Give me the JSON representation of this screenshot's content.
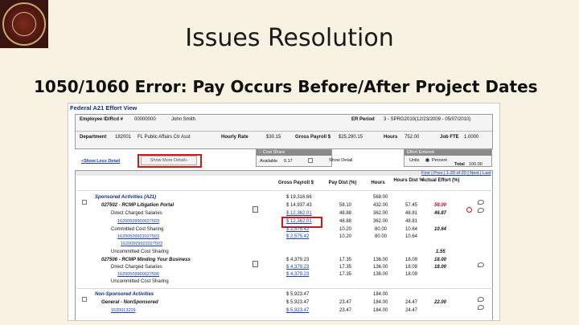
{
  "slide": {
    "title": "Issues Resolution",
    "subtitle": "1050/1060 Error: Pay Occurs Before/After Project Dates",
    "seal": {
      "ring_text": "FLORIDA STATE UNIVERSITY",
      "year": "1851"
    }
  },
  "colors": {
    "background": "#f7f2e1",
    "seal": "#4a1510",
    "highlight": "#d01818",
    "link": "#1a3fb0",
    "navy": "#15307a"
  },
  "screen": {
    "panel_title": "Federal A21 Effort View",
    "header": {
      "employee_label": "Employee ID/Rcd #",
      "employee_value": "00000000",
      "employee_name": "John Smith",
      "er_period_label": "ER Period",
      "er_period_value": "3 - SPRG2010(12/23/2009 - 05/07/2010)",
      "department_label": "Department",
      "department_id": "182001",
      "department_name": "FL Public Affairs Ctr Asst",
      "hourly_rate_label": "Hourly Rate",
      "hourly_rate_value": "$30.15",
      "gross_payroll_label": "Gross Payroll $",
      "gross_payroll_value": "$25,290.15",
      "hours_label": "Hours",
      "hours_value": "752.00",
      "job_fte_label": "Job FTE",
      "job_fte_value": "1.0000"
    },
    "controls": {
      "show_less": "Show Less Detail",
      "show_more": "Show More Detail",
      "cost_share_title": "Cost Share",
      "available_label": "Available",
      "available_value": "0.17",
      "show_detail_label": "Show Detail",
      "effort_title": "Effort Entered",
      "units_label": "Units",
      "percent_label": "Percent",
      "total_label": "Total",
      "total_value": "100.00",
      "pager_text": "First | Prev | 1-20 of 20 | Next | Last"
    },
    "columns": {
      "gross_payroll": "Gross Payroll $",
      "pay_dist": "Pay Dist (%)",
      "hours": "Hours",
      "hours_dist": "Hours Dist %",
      "actual_effort": "Actual Effort (%)"
    },
    "rows": [
      {
        "label": "Sponsored Activities (A21)",
        "gross": "$ 19,316.66",
        "pay": "",
        "hours": "568.00",
        "hdist": "",
        "effort": ""
      },
      {
        "label": "027502 - RCMP Litigation Portal",
        "gross": "$ 14,937.43",
        "pay": "58.10",
        "hours": "432.00",
        "hdist": "57.45",
        "effort": "58.00"
      },
      {
        "label": "Direct Charged Salaries",
        "gross": "$ 12,362.01",
        "pay": "48.88",
        "hours": "362.00",
        "hdist": "48.81",
        "effort": "46.87"
      },
      {
        "label": "16200509900027503",
        "gross": "$ 12,362.01",
        "pay": "48.88",
        "hours": "362.00",
        "hdist": "48.81",
        "effort": ""
      },
      {
        "label": "Committed Cost Sharing",
        "gross": "$ 2,575.42",
        "pay": "10.20",
        "hours": "80.00",
        "hdist": "10.64",
        "effort": "10.64"
      },
      {
        "label": "16200509922027503",
        "gross": "$ 2,575.42",
        "pay": "10.20",
        "hours": "80.00",
        "hdist": "10.64",
        "effort": ""
      },
      {
        "label": "16200509922027503",
        "gross": "",
        "pay": "",
        "hours": "",
        "hdist": "",
        "effort": ""
      },
      {
        "label": "Uncommitted Cost Sharing",
        "gross": "",
        "pay": "",
        "hours": "",
        "hdist": "",
        "effort": "1.55"
      },
      {
        "label": "027506 - RCMP Minding Your Business",
        "gross": "$ 4,379.23",
        "pay": "17.35",
        "hours": "136.00",
        "hdist": "18.09",
        "effort": "18.00"
      },
      {
        "label": "Direct Charged Salaries",
        "gross": "$ 4,379.23",
        "pay": "17.35",
        "hours": "136.00",
        "hdist": "18.09",
        "effort": "18.00"
      },
      {
        "label": "16200509900027506",
        "gross": "$ 4,379.23",
        "pay": "17.35",
        "hours": "136.00",
        "hdist": "18.09",
        "effort": ""
      },
      {
        "label": "Uncommitted Cost Sharing",
        "gross": "",
        "pay": "",
        "hours": "",
        "hdist": "",
        "effort": ""
      },
      {
        "label": "Non-Sponsored Activities",
        "gross": "$ 5,923.47",
        "pay": "",
        "hours": "184.00",
        "hdist": "",
        "effort": ""
      },
      {
        "label": "General - NonSponsored",
        "gross": "$ 5,923.47",
        "pay": "23.47",
        "hours": "184.00",
        "hdist": "24.47",
        "effort": "22.00"
      },
      {
        "label": "1620013209",
        "gross": "$ 5,923.47",
        "pay": "23.47",
        "hours": "184.00",
        "hdist": "24.47",
        "effort": ""
      }
    ]
  }
}
